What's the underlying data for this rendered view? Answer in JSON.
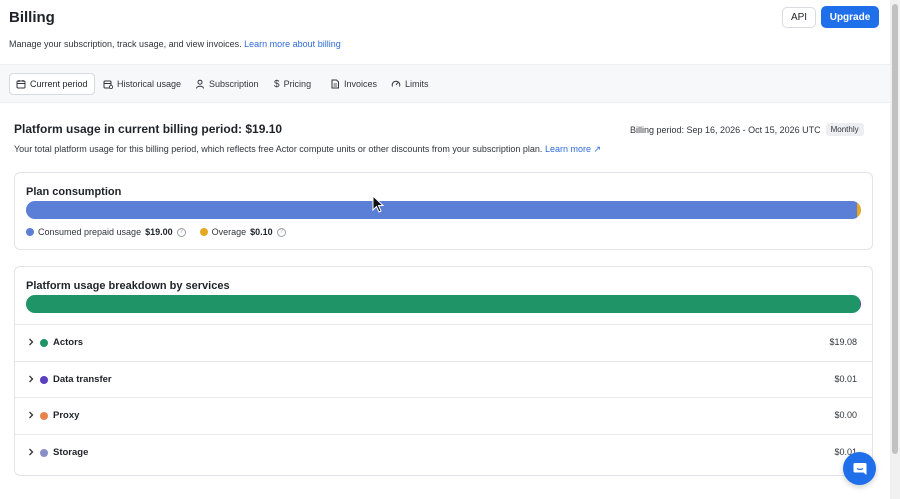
{
  "header": {
    "title": "Billing",
    "subtitle": "Manage your subscription, track usage, and view invoices.",
    "subtitle_link": "Learn more about billing",
    "api_label": "API",
    "upgrade_label": "Upgrade"
  },
  "tabs": [
    {
      "label": "Current period",
      "icon": "calendar-icon",
      "active": true
    },
    {
      "label": "Historical usage",
      "icon": "calendar-history-icon",
      "active": false
    },
    {
      "label": "Subscription",
      "icon": "user-icon",
      "active": false
    },
    {
      "label": "Pricing",
      "icon": "dollar-icon",
      "active": false
    },
    {
      "label": "Invoices",
      "icon": "document-icon",
      "active": false
    },
    {
      "label": "Limits",
      "icon": "gauge-icon",
      "active": false
    }
  ],
  "usage": {
    "title": "Platform usage in current billing period: $19.10",
    "period": "Billing period: Sep 16, 2026 - Oct 15, 2026 UTC",
    "badge": "Monthly",
    "description": "Your total platform usage for this billing period, which reflects free Actor compute units or other discounts from your subscription plan.",
    "learn_more": "Learn more ↗"
  },
  "plan": {
    "title": "Plan consumption",
    "consumed_label": "Consumed prepaid usage",
    "consumed_value": "$19.00",
    "consumed_amount": 19.0,
    "overage_label": "Overage",
    "overage_value": "$0.10",
    "overage_amount": 0.1,
    "consumed_color": "#5b7fd6",
    "overage_color": "#e5a823"
  },
  "breakdown": {
    "title": "Platform usage breakdown by services",
    "services": [
      {
        "name": "Actors",
        "value": "$19.08",
        "amount": 19.08,
        "color": "#1f9467"
      },
      {
        "name": "Data transfer",
        "value": "$0.01",
        "amount": 0.01,
        "color": "#5a3fc0"
      },
      {
        "name": "Proxy",
        "value": "$0.00",
        "amount": 0.0,
        "color": "#e8834d"
      },
      {
        "name": "Storage",
        "value": "$0.01",
        "amount": 0.01,
        "color": "#8b8fc7"
      }
    ]
  },
  "colors": {
    "accent": "#1f6feb",
    "link": "#2e6bd9"
  }
}
